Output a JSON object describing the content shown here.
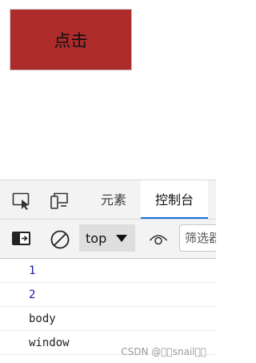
{
  "page": {
    "button_label": "点击"
  },
  "devtools": {
    "tabs": [
      {
        "label": "元素",
        "active": false
      },
      {
        "label": "控制台",
        "active": true
      }
    ],
    "toolbar": {
      "context": "top",
      "filter_placeholder": "筛选器"
    },
    "console_rows": [
      {
        "text": "1",
        "kind": "number"
      },
      {
        "text": "2",
        "kind": "number"
      },
      {
        "text": "body",
        "kind": "string"
      },
      {
        "text": "window",
        "kind": "string"
      }
    ]
  },
  "watermark": "CSDN @\u0000\u0000snail\u0000\u0000",
  "colors": {
    "button_bg": "#ad2b2b",
    "tab_active_underline": "#1a73e8",
    "number_log": "#1a1aa6"
  },
  "icons": [
    "device-inspect-icon",
    "device-toggle-icon",
    "sidebar-toggle-icon",
    "clear-console-icon",
    "live-expression-eye-icon"
  ]
}
